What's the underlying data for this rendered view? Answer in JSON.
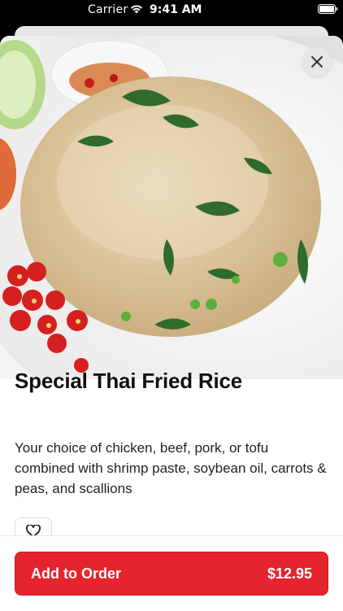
{
  "status_bar": {
    "carrier": "Carrier",
    "time": "9:41 AM"
  },
  "item": {
    "name": "Special Thai Fried Rice",
    "description": "Your choice of chicken, beef, pork, or tofu combined with shrimp paste, soybean oil, carrots & peas, and scallions",
    "price": "$12.95"
  },
  "actions": {
    "add_label": "Add to Order"
  },
  "colors": {
    "accent": "#e5242d"
  },
  "icons": {
    "close": "close-icon",
    "favorite": "heart-icon",
    "wifi": "wifi-icon",
    "battery": "battery-icon"
  }
}
